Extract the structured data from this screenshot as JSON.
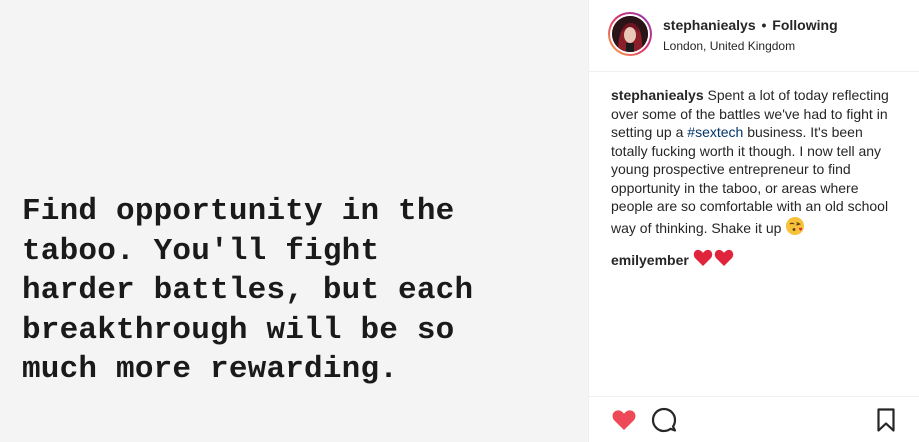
{
  "post_image": {
    "quote_lines": [
      "Find opportunity in the",
      "taboo. You'll fight",
      "harder battles, but each",
      "breakthrough will be so",
      "much more rewarding."
    ]
  },
  "header": {
    "username": "stephaniealys",
    "separator": "•",
    "follow_status": "Following",
    "location": "London, United Kingdom"
  },
  "caption": {
    "username": "stephaniealys",
    "text_before_hashtag": "Spent a lot of today reflecting over some of the battles we've had to fight in setting up a ",
    "hashtag": "#sextech",
    "text_after_hashtag": " business. It's been totally fucking worth it though. I now tell any young prospective entrepreneur to find opportunity in the taboo, or areas where people are so comfortable with an old school way of thinking. Shake it up",
    "emoji": "kissing-face-with-heart-emoji"
  },
  "comments": [
    {
      "username": "emilyember",
      "emoji": "two-red-hearts-emoji"
    }
  ],
  "actions": {
    "like_icon": "heart-icon",
    "like_state": "liked",
    "comment_icon": "speech-bubble-icon",
    "save_icon": "bookmark-icon"
  },
  "colors": {
    "liked_heart": "#ed4956",
    "hashtag_link": "#003569",
    "text": "#262626",
    "image_background": "#f4f4f4"
  }
}
